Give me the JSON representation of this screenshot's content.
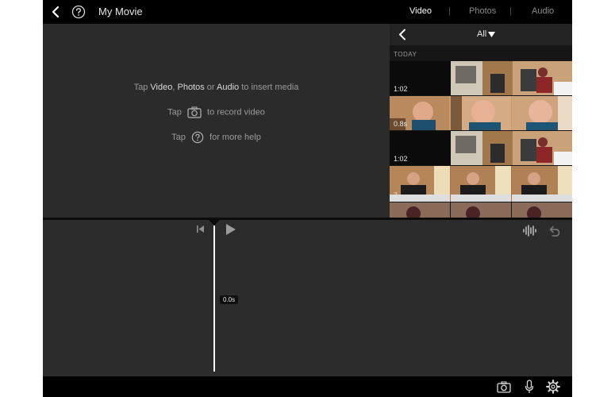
{
  "header": {
    "title": "My Movie",
    "tabs": [
      {
        "label": "Video",
        "active": true
      },
      {
        "label": "Photos",
        "active": false
      },
      {
        "label": "Audio",
        "active": false
      }
    ],
    "separator": "|"
  },
  "preview": {
    "line1": {
      "pre": "Tap ",
      "video": "Video",
      "comma": ", ",
      "photos": "Photos",
      "or": " or ",
      "audio": "Audio",
      "post": " to insert media"
    },
    "line2": {
      "pre": "Tap",
      "post": "to record video"
    },
    "line3": {
      "pre": "Tap",
      "post": "for more help"
    }
  },
  "browser": {
    "filter": "All",
    "section": "TODAY",
    "clips": [
      {
        "duration": "1:02",
        "kind": "office-chair"
      },
      {
        "duration": "0.8s",
        "kind": "face"
      },
      {
        "duration": "1:02",
        "kind": "office-chair"
      },
      {
        "duration": "7",
        "kind": "desk-shot"
      },
      {
        "duration": "",
        "kind": "partial"
      }
    ]
  },
  "timeline": {
    "time": "0.0s"
  },
  "icons": {
    "back": "chevron-left-icon",
    "help": "question-circle-icon",
    "filter_caret": "caret-down-icon",
    "skip_start": "skip-to-start-icon",
    "play": "play-icon",
    "waveform": "waveform-icon",
    "undo": "undo-icon",
    "camera": "camera-icon",
    "microphone": "microphone-icon",
    "settings": "gear-icon"
  },
  "colors": {
    "bar": "#000000",
    "panel": "#2b2b2b",
    "text_active": "#ffffff",
    "text_inactive": "#8c8c8c"
  }
}
